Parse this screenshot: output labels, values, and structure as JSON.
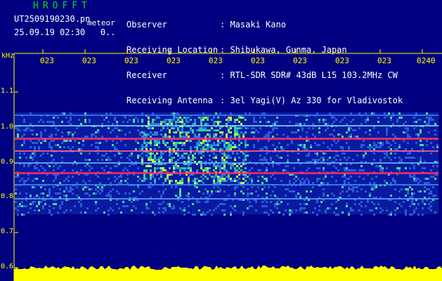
{
  "header": {
    "logo": "HROFFT",
    "filename": "UT2509190230.pn",
    "meteor_label": "meteor",
    "date_time": "25.09.19 02:30   0..",
    "fields": [
      {
        "label": "Observer",
        "value": ": Masaki Kano"
      },
      {
        "label": "Receiving Location",
        "value": ": Shibukawa, Gunma, Japan"
      },
      {
        "label": "Receiver",
        "value": ": RTL-SDR SDR# 43dB L15 103.2MHz CW"
      },
      {
        "label": "Receiving Antenna",
        "value": ": 3el Yagi(V) Az 330 for Vladivostok"
      }
    ]
  },
  "axis": {
    "unit": "kHz",
    "yticks": [
      "1.1",
      "1.0",
      "0.9",
      "0.8",
      "0.7",
      "0.6"
    ],
    "xticks": [
      "023",
      "023",
      "023",
      "023",
      "023",
      "023",
      "023",
      "023",
      "023",
      "0240"
    ]
  },
  "colors": {
    "background": "#000080",
    "axis": "#ffff00",
    "band_hot": "#ff2a6a",
    "signal_yellow": "#ffff00"
  }
}
